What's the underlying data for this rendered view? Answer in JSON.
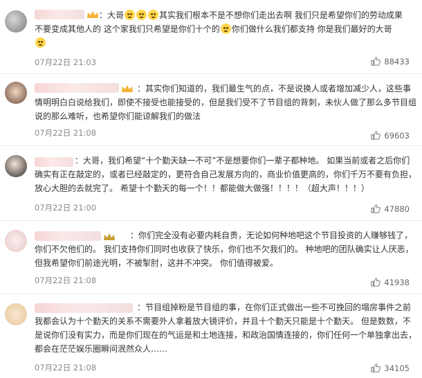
{
  "comments": [
    {
      "text_parts": [
        "：大哥",
        "",
        "",
        "",
        "其实我们根本不是不想你们走出去啊 我们只是希望你们的劳动成果不要变成其他人的 这个家我们只希望是你们十个的",
        "",
        "你们做什么我们都支持 你是我们最好的大哥",
        ""
      ],
      "date": "07月22日 21:03",
      "likes": "88433"
    },
    {
      "text": "：其实你们知道的，我们最生气的点，不是说换人或者增加减少人，这些事情明明白白说给我们，即使不接受也能接受的，但是我们受不了节目组的背刺，未伙人做了那么多节目组说的那么难听，也希望你们能谅解我们的做法",
      "date": "07月22日 21:08",
      "likes": "69603"
    },
    {
      "text": "：大哥，我们希望“十个勤天缺一不可”不是想要你们一辈子都种地。 如果当前或者之后你们确实有正在敲定的，或者已经敲定的，更符合自己发展方向的，商业价值更高的，你们千万不要有负担，放心大胆的去就完了。 希望十个勤天的每一个！！都能做大做强！！！！（超大声！！！）",
      "date": "07月22日 21:00",
      "likes": "47880"
    },
    {
      "text": "：你们完全没有必要内耗自责，无论如何种地吧这个节目投资的人赚够钱了，你们不欠他们的。 我们支持你们同时也收获了快乐，你们也不欠我们的。 种地吧的团队确实让人厌恶，但我希望你们前途光明，不被掣肘，这并不冲突。 你们值得被爱。",
      "date": "07月22日 21:08",
      "likes": "41938"
    },
    {
      "text": "：节目组掉粉是节目组的事，在你们正式做出一些不可挽回的塌房事件之前我都会认为十个勤天的关系不需要外人拿着放大镜评价，并且十个勤天只能是十个勤天。 但是数数，不是说你们没有实力，而是你们现在的气运是和土地连接，和政治国情连接的，你们任何一个单独拿出去，都会在茫茫娱乐圈瞬间泯然众人……",
      "date": "07月22日 21:08",
      "likes": "34105"
    }
  ],
  "colors": {
    "text": "#333333",
    "meta": "#888888",
    "emoji": "#ffd54a",
    "name_blur": "#f6d6d6"
  },
  "icons": {
    "like": "thumbs-up-icon",
    "emoji": "crying-face-emoji",
    "vip": "crown-badge-icon"
  }
}
